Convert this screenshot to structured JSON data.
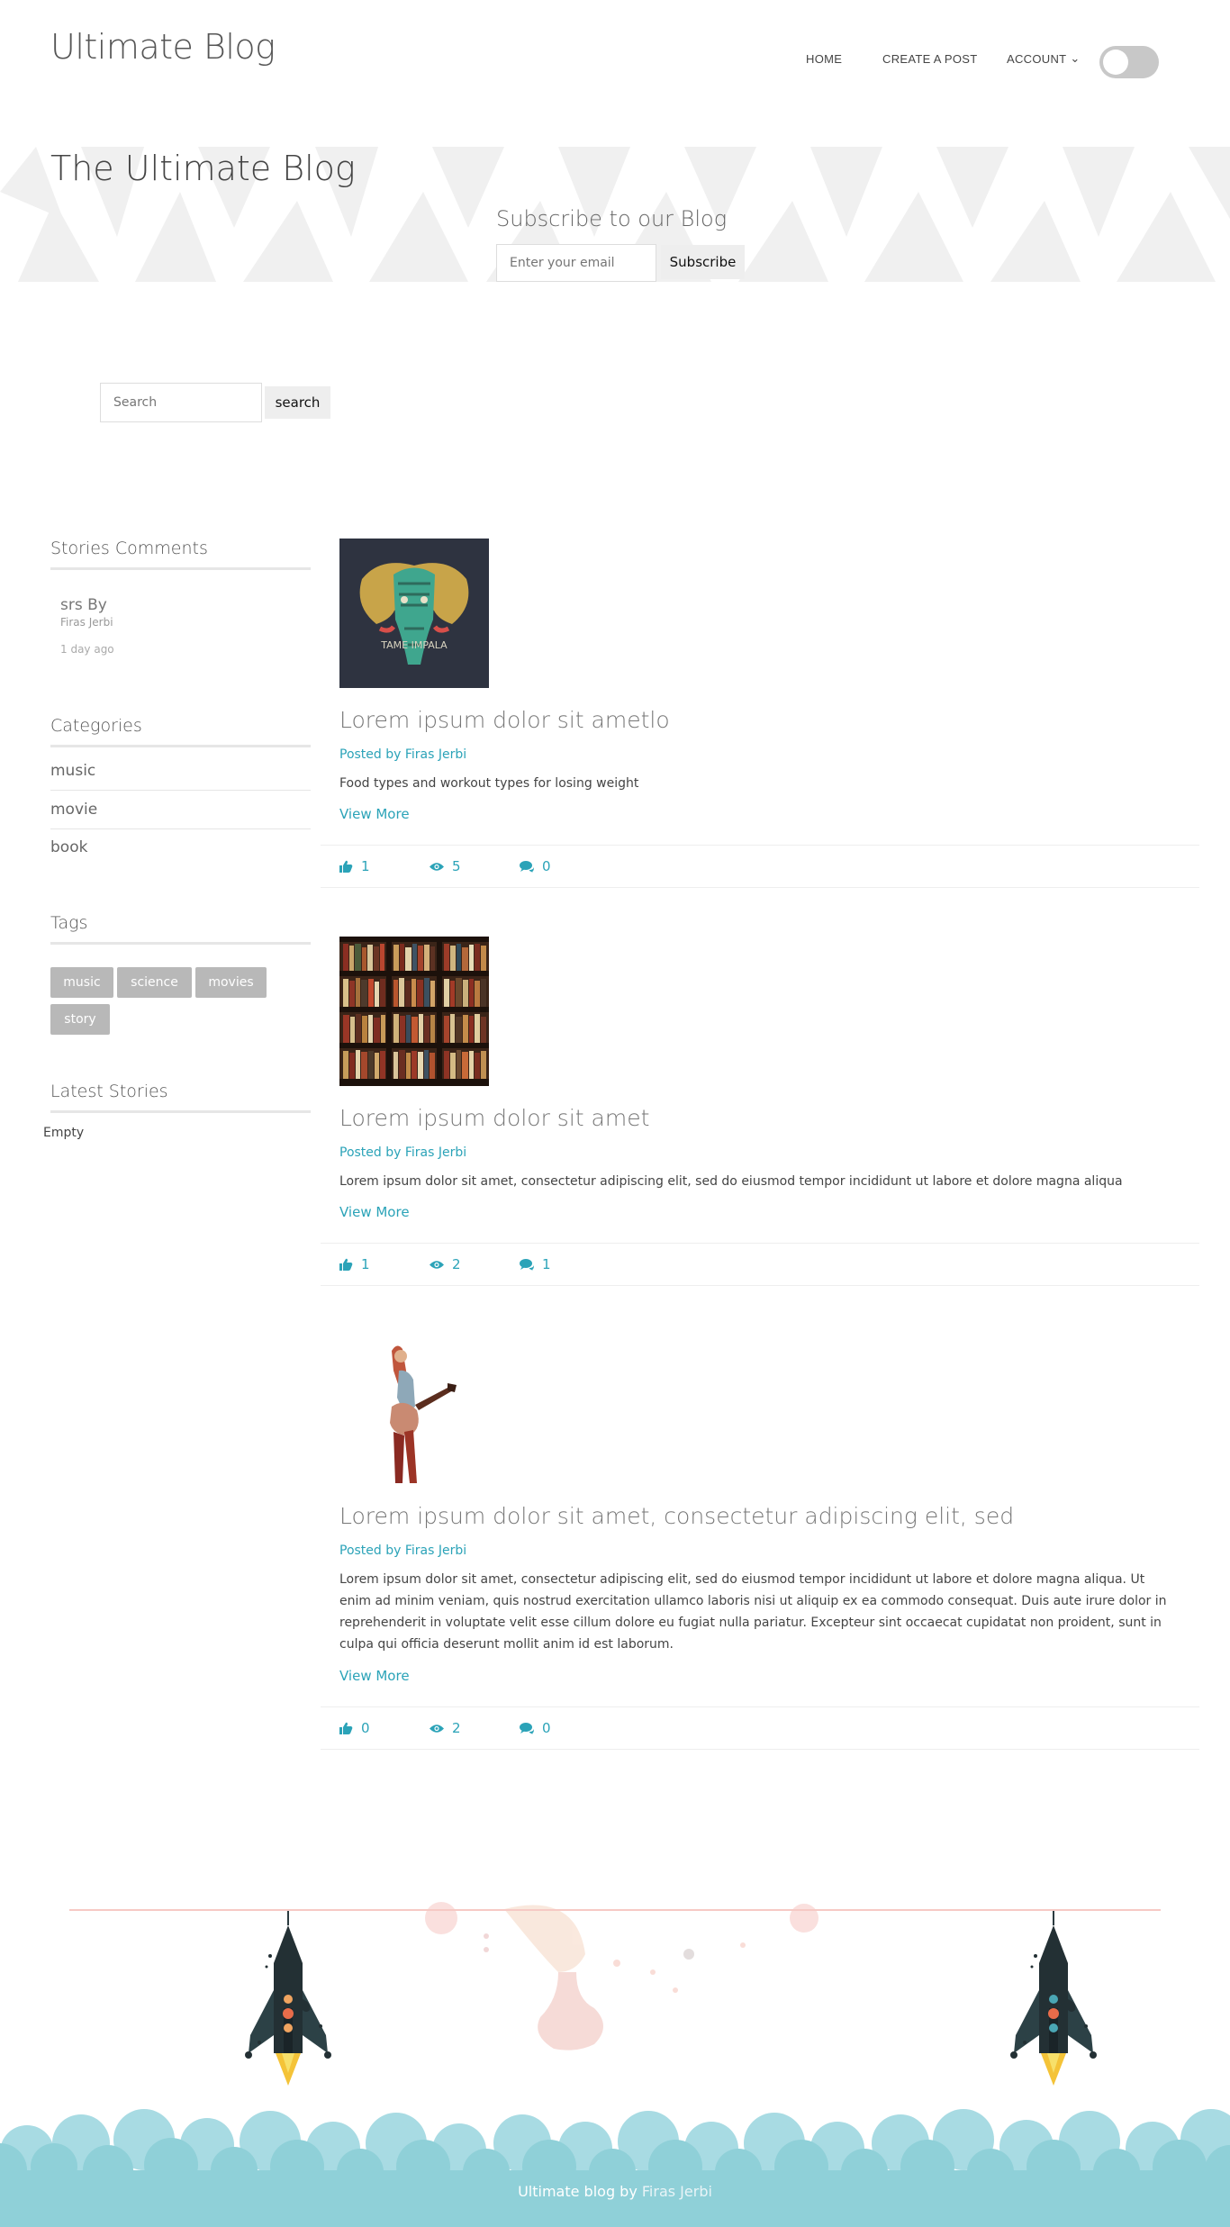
{
  "header": {
    "site_title": "Ultimate Blog",
    "nav": {
      "home": "HOME",
      "create_post": "CREATE A POST",
      "account": "ACCOUNT"
    }
  },
  "banner": {
    "title": "The Ultimate Blog",
    "subscribe_title": "Subscribe to our Blog",
    "email_placeholder": "Enter your email",
    "subscribe_button": "Subscribe"
  },
  "search": {
    "placeholder": "Search",
    "button": "search"
  },
  "sidebar": {
    "comments_heading": "Stories Comments",
    "comment": {
      "title": "srs By",
      "author": "Firas Jerbi",
      "time": "1 day ago"
    },
    "categories_heading": "Categories",
    "categories": [
      "music",
      "movie",
      "book"
    ],
    "tags_heading": "Tags",
    "tags": [
      "music",
      "science",
      "movies",
      "story"
    ],
    "latest_heading": "Latest Stories",
    "latest_empty": "Empty"
  },
  "posts": [
    {
      "title": "Lorem ipsum dolor sit ametlo",
      "by": "Posted by Firas Jerbi",
      "excerpt": "Food types and workout types for losing weight",
      "more": "View More",
      "likes": "1",
      "views": "5",
      "comments": "0"
    },
    {
      "title": "Lorem ipsum dolor sit amet",
      "by": "Posted by Firas Jerbi",
      "excerpt": "Lorem ipsum dolor sit amet, consectetur adipiscing elit, sed do eiusmod tempor incididunt ut labore et dolore magna aliqua",
      "more": "View More",
      "likes": "1",
      "views": "2",
      "comments": "1"
    },
    {
      "title": "Lorem ipsum dolor sit amet, consectetur adipiscing elit, sed",
      "by": "Posted by Firas Jerbi",
      "excerpt": "Lorem ipsum dolor sit amet, consectetur adipiscing elit, sed do eiusmod tempor incididunt ut labore et dolore magna aliqua. Ut enim ad minim veniam, quis nostrud exercitation ullamco laboris nisi ut aliquip ex ea commodo consequat. Duis aute irure dolor in reprehenderit in voluptate velit esse cillum dolore eu fugiat nulla pariatur. Excepteur sint occaecat cupidatat non proident, sunt in culpa qui officia deserunt mollit anim id est laborum.",
      "more": "View More",
      "likes": "0",
      "views": "2",
      "comments": "0"
    }
  ],
  "footer": {
    "text": "Ultimate blog by ",
    "author": "Firas Jerbi"
  },
  "colors": {
    "accent": "#2ba3b8",
    "footer_cloud": "#8fd0d8",
    "footer_line": "#f6c9c4"
  }
}
